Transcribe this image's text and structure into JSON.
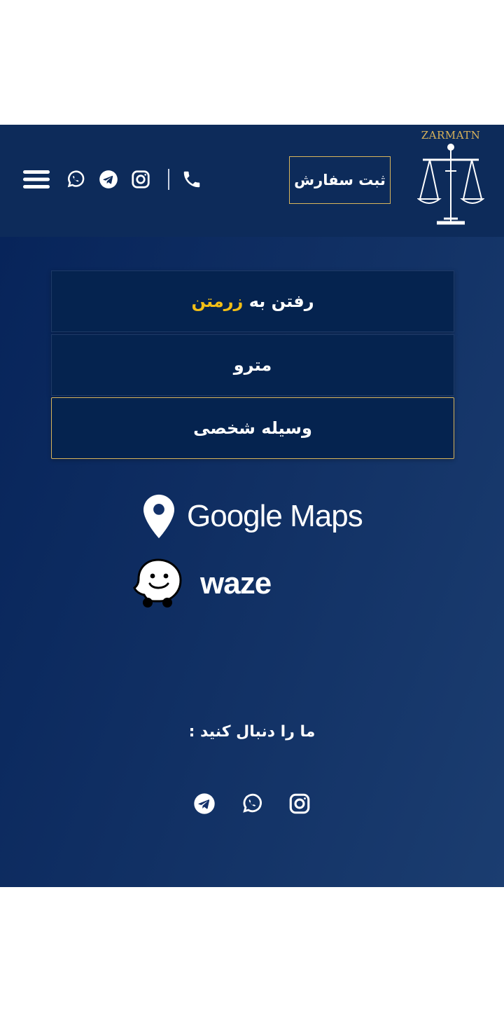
{
  "header": {
    "brand": "ZARMATN",
    "order_button": "ثبت سفارش",
    "icons": [
      "menu-icon",
      "whatsapp-icon",
      "telegram-icon",
      "instagram-icon",
      "phone-icon"
    ]
  },
  "tabs": [
    {
      "label_prefix": "رفتن به",
      "label_highlight": "زرمتن",
      "active": false
    },
    {
      "label": "مترو",
      "active": false
    },
    {
      "label": "وسیله شخصی",
      "active": true
    }
  ],
  "maps": {
    "google_label": "Google Maps",
    "waze_label": "waze"
  },
  "follow": {
    "title": "ما را دنبال کنید :",
    "icons": [
      "telegram-icon",
      "whatsapp-icon",
      "instagram-icon"
    ]
  },
  "colors": {
    "header_bg": "#0d2b5a",
    "accent_gold": "#d9b55b",
    "highlight_yellow": "#f2be16",
    "tab_bg": "#05234f"
  }
}
